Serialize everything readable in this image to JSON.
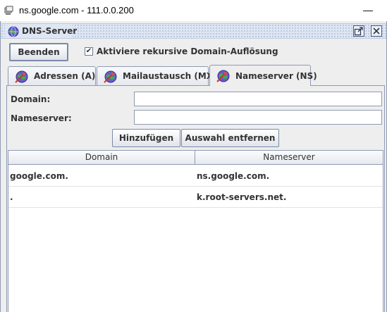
{
  "os_window": {
    "title": "ns.google.com - 111.0.0.200",
    "minimize_glyph": "—",
    "icon": "network-app-icon"
  },
  "frame": {
    "title": "DNS-Server",
    "icon": "dns-globe-icon"
  },
  "toolbar": {
    "quit_label": "Beenden",
    "recursive_label": "Aktiviere rekursive Domain-Auflösung",
    "recursive_checked": true,
    "check_glyph": "✔"
  },
  "tabs": [
    {
      "label": "Adressen (A)",
      "selected": false
    },
    {
      "label": "Mailaustausch (MX)",
      "selected": false
    },
    {
      "label": "Nameserver (NS)",
      "selected": true
    }
  ],
  "form": {
    "domain_label": "Domain:",
    "domain_value": "",
    "nameserver_label": "Nameserver:",
    "nameserver_value": "",
    "add_label": "Hinzufügen",
    "remove_label": "Auswahl entfernen"
  },
  "table": {
    "columns": [
      "Domain",
      "Nameserver"
    ],
    "rows": [
      {
        "domain": "google.com.",
        "nameserver": "ns.google.com."
      },
      {
        "domain": ".",
        "nameserver": "k.root-servers.net."
      }
    ]
  }
}
